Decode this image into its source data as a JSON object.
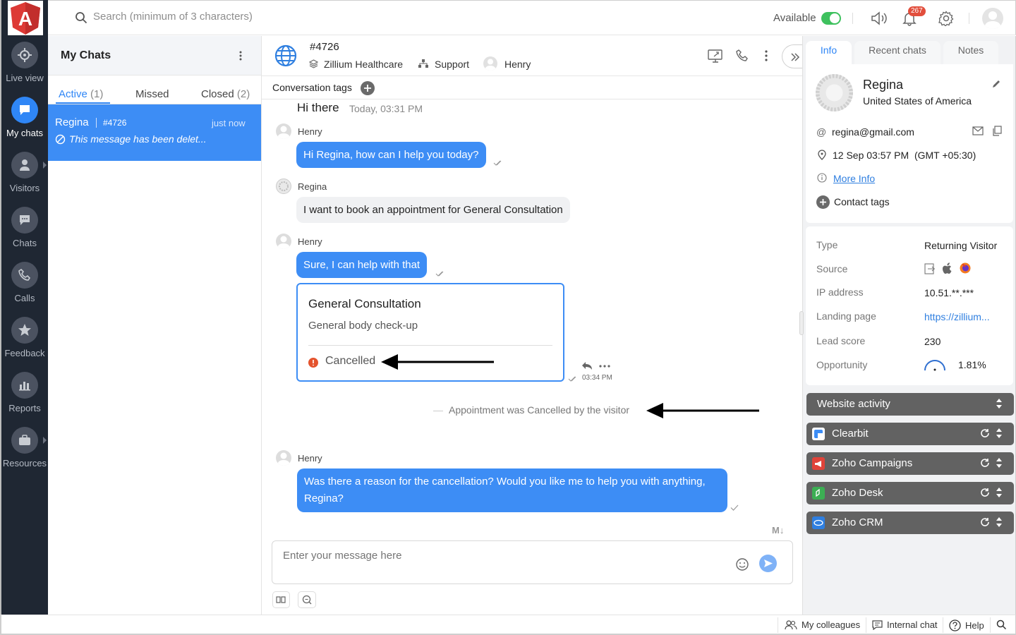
{
  "app": {
    "logo_letter": "A"
  },
  "nav": {
    "items": [
      {
        "label": "Live view",
        "icon": "crosshair-icon"
      },
      {
        "label": "My chats",
        "icon": "chat-bubble-icon",
        "active": true
      },
      {
        "label": "Visitors",
        "icon": "person-icon"
      },
      {
        "label": "Chats",
        "icon": "message-icon"
      },
      {
        "label": "Calls",
        "icon": "phone-icon"
      },
      {
        "label": "Feedback",
        "icon": "star-icon"
      },
      {
        "label": "Reports",
        "icon": "bar-chart-icon"
      },
      {
        "label": "Resources",
        "icon": "briefcase-icon"
      }
    ]
  },
  "topbar": {
    "search_placeholder": "Search (minimum of 3 characters)",
    "status_label": "Available",
    "notification_count": "267"
  },
  "chatlist": {
    "title": "My Chats",
    "tabs": [
      {
        "label": "Active",
        "count": "(1)"
      },
      {
        "label": "Missed",
        "count": ""
      },
      {
        "label": "Closed",
        "count": "(2)"
      }
    ],
    "items": [
      {
        "name": "Regina",
        "id": "#4726",
        "time": "just now",
        "preview": "This message has been delet..."
      }
    ]
  },
  "conversation": {
    "id": "#4726",
    "company": "Zillium Healthcare",
    "department": "Support",
    "agent": "Henry",
    "tags_label": "Conversation tags",
    "greeting": "Hi there",
    "greeting_time": "Today, 03:31 PM",
    "messages": [
      {
        "sender": "Henry",
        "text": "Hi Regina, how can I help you today?"
      },
      {
        "sender": "Regina",
        "text": "I want to book an appointment for General Consultation"
      },
      {
        "sender": "Henry",
        "text": "Sure, I can help with that"
      },
      {
        "sender": "Henry",
        "text": "Was there a reason for the cancellation? Would you like me to help you with anything, Regina?"
      }
    ],
    "card": {
      "title": "General Consultation",
      "subtitle": "General body check-up",
      "status": "Cancelled",
      "time": "03:34 PM"
    },
    "system_message": "Appointment was Cancelled by the visitor",
    "composer_placeholder": "Enter your message here",
    "markdown_badge": "M↓"
  },
  "visitor": {
    "tabs": [
      "Info",
      "Recent chats",
      "Notes"
    ],
    "name": "Regina",
    "country": "United States of America",
    "email": "regina@gmail.com",
    "local_time": "12 Sep 03:57 PM  (GMT +05:30)",
    "more_info": "More Info",
    "contact_tags": "Contact tags",
    "props": [
      {
        "label": "Type",
        "value": "Returning Visitor"
      },
      {
        "label": "Source",
        "value": ""
      },
      {
        "label": "IP address",
        "value": "10.51.**.***"
      },
      {
        "label": "Landing page",
        "value": "https://zillium..."
      },
      {
        "label": "Lead score",
        "value": "230"
      },
      {
        "label": "Opportunity",
        "value": "1.81%"
      }
    ],
    "widgets": [
      {
        "label": "Website activity",
        "color": "#626262"
      },
      {
        "label": "Clearbit",
        "color": "#3d8df5"
      },
      {
        "label": "Zoho Campaigns",
        "color": "#e0443a"
      },
      {
        "label": "Zoho Desk",
        "color": "#3cae53"
      },
      {
        "label": "Zoho CRM",
        "color": "#2f7fe0"
      }
    ]
  },
  "footer": {
    "colleagues": "My colleagues",
    "internal_chat": "Internal chat",
    "help": "Help"
  }
}
